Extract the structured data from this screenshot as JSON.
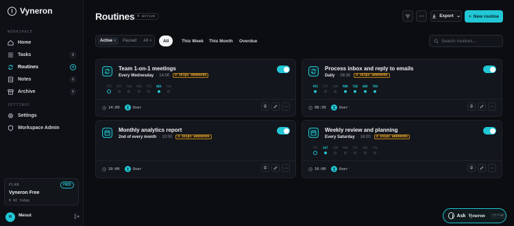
{
  "app": {
    "name": "Vyneron"
  },
  "sidebar": {
    "workspace_label": "WORKSPACE",
    "settings_label": "SETTINGS",
    "items": [
      {
        "label": "Home",
        "icon": "home-icon",
        "count": ""
      },
      {
        "label": "Tasks",
        "icon": "tasks-icon",
        "count": "0"
      },
      {
        "label": "Routines",
        "icon": "routines-icon",
        "count": "4"
      },
      {
        "label": "Notes",
        "icon": "notes-icon",
        "count": "0"
      },
      {
        "label": "Archive",
        "icon": "archive-icon",
        "count": "0"
      }
    ],
    "settings_items": [
      {
        "label": "Settings",
        "icon": "gear-icon"
      },
      {
        "label": "Workspace Admin",
        "icon": "shield-icon"
      }
    ],
    "plan": {
      "label": "PLAN",
      "badge": "FREE",
      "name": "Vyneron Free",
      "sub": "0 AI today"
    },
    "user": {
      "initials": "M",
      "name": "Mesut"
    }
  },
  "header": {
    "title": "Routines",
    "badge": "4 active",
    "export_label": "Export",
    "new_label": "New routine"
  },
  "filters": {
    "segments": [
      {
        "label": "Active",
        "count": "4"
      },
      {
        "label": "Paused",
        "count": ""
      },
      {
        "label": "All",
        "count": "4"
      }
    ],
    "chips": [
      "All",
      "This Week",
      "This Month",
      "Overdue"
    ],
    "search_placeholder": "Search routines..."
  },
  "day_labels": [
    "FRI",
    "SAT",
    "SUN",
    "MON",
    "TUE",
    "WED",
    "THU"
  ],
  "routines": [
    {
      "title": "Team 1-on-1 meetings",
      "freq": "Every Wednesday",
      "time": "14:00",
      "skip": "skips weekends",
      "icon": "refresh-icon",
      "days_on": [
        false,
        false,
        false,
        false,
        false,
        true,
        false
      ],
      "today_index": 0,
      "foot_time": "14:00",
      "owner": "User",
      "enabled": true
    },
    {
      "title": "Process inbox and reply to emails",
      "freq": "Daily",
      "time": "08:30",
      "skip": "skips weekends",
      "icon": "refresh-icon",
      "days_on": [
        true,
        false,
        false,
        true,
        true,
        true,
        true
      ],
      "today_index": 0,
      "foot_time": "08:30",
      "owner": "User",
      "enabled": true
    },
    {
      "title": "Monthly analytics report",
      "freq": "2nd of every month",
      "time": "10:00",
      "skip": "skips weekends",
      "icon": "calendar-icon",
      "days_on": [],
      "today_index": -1,
      "foot_time": "10:00",
      "owner": "User",
      "enabled": true
    },
    {
      "title": "Weekly review and planning",
      "freq": "Every Saturday",
      "time": "16:00",
      "skip": "skips weekends",
      "icon": "calendar-icon",
      "days_on": [
        false,
        true,
        false,
        false,
        false,
        false,
        false
      ],
      "today_index": 0,
      "foot_time": "16:00",
      "owner": "User",
      "enabled": true
    }
  ],
  "assistant": {
    "ask": "Ask",
    "brand": "Vyneron",
    "shortcut": "Ctrl+K"
  },
  "colors": {
    "accent": "#22c7d6",
    "warning": "#e0a537",
    "background": "#0b0d11",
    "card": "#13161c"
  }
}
